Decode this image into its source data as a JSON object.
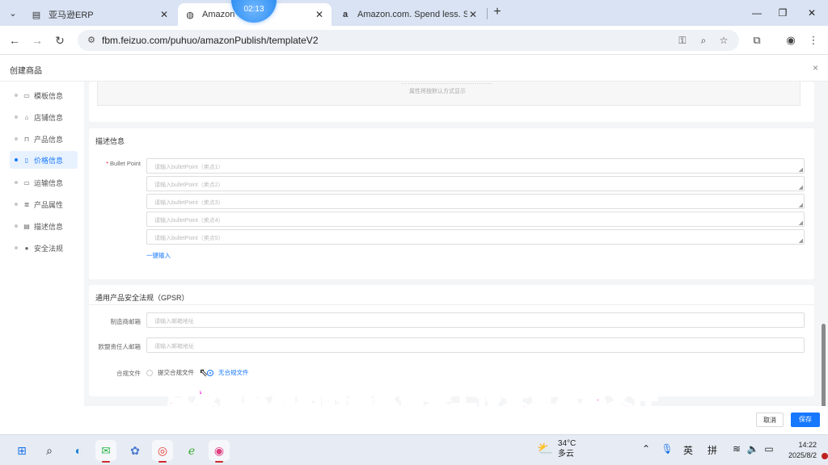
{
  "browser": {
    "tabs": [
      {
        "title": "亚马逊ERP",
        "favicon": "erp-icon",
        "active": false
      },
      {
        "title": "Amazon",
        "favicon": "globe-icon",
        "active": true
      },
      {
        "title": "Amazon.com. Spend less. Sm",
        "favicon": "amazon-a-icon",
        "active": false
      }
    ],
    "recording_timer": "02:13",
    "url": "fbm.feizuo.com/puhuo/amazonPublish/templateV2"
  },
  "page": {
    "title": "创建商品"
  },
  "sidebar": {
    "items": [
      {
        "label": "模板信息",
        "icon": "doc-icon",
        "active": false
      },
      {
        "label": "店铺信息",
        "icon": "home-icon",
        "active": false
      },
      {
        "label": "产品信息",
        "icon": "box-icon",
        "active": false
      },
      {
        "label": "价格信息",
        "icon": "price-icon",
        "active": true
      },
      {
        "label": "运输信息",
        "icon": "truck-icon",
        "active": false
      },
      {
        "label": "产品属性",
        "icon": "list-icon",
        "active": false
      },
      {
        "label": "描述信息",
        "icon": "doc-icon",
        "active": false
      },
      {
        "label": "安全法规",
        "icon": "shield-icon",
        "active": false
      }
    ]
  },
  "top_card": {
    "hint_cut": "……………………………………",
    "hint": "属性将按默认方式显示"
  },
  "description": {
    "section_title": "描述信息",
    "bullet_label": "Bullet Point",
    "bullet_placeholders": [
      "请输入bulletPoint（卖点1）",
      "请输入bulletPoint（卖点2）",
      "请输入bulletPoint（卖点3）",
      "请输入bulletPoint（卖点4）",
      "请输入bulletPoint（卖点5）"
    ],
    "one_click_input": "一键输入"
  },
  "gpsr": {
    "section_title": "通用产品安全法规（GPSR）",
    "manufacturer_email_label": "制造商邮箱",
    "manufacturer_email_placeholder": "请输入邮箱地址",
    "eu_responsible_label": "欧盟责任人邮箱",
    "eu_responsible_placeholder": "请输入邮箱地址",
    "compliance_label": "合规文件",
    "options": [
      {
        "label": "提交合规文件",
        "checked": false
      },
      {
        "label": "无合规文件",
        "checked": true
      }
    ]
  },
  "footer": {
    "cancel": "取消",
    "save": "保存"
  },
  "subtitle": "以及做欧洲站的卖家需要上传安全法规文件",
  "taskbar": {
    "weather_temp": "34°C",
    "weather_desc": "多云",
    "ime_lang": "英",
    "ime_mode": "拼",
    "time": "14:22",
    "date": "2025/8/2"
  },
  "colors": {
    "accent": "#1677ff",
    "subtitle": "#ff33dd",
    "required": "#f5222d"
  }
}
